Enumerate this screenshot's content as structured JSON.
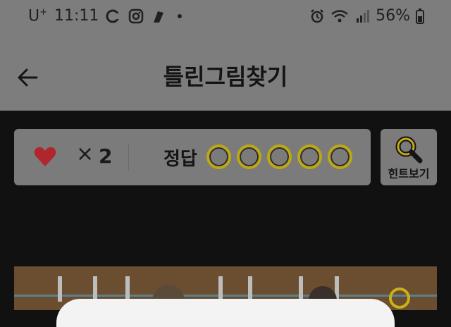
{
  "status_bar": {
    "carrier": "U",
    "carrier_sup": "+",
    "time": "11:11",
    "battery": "56%"
  },
  "header": {
    "title": "틀린그림찾기"
  },
  "game": {
    "times": "×",
    "lives": "2",
    "answer_label": "정답",
    "found": 0,
    "total": 5
  },
  "hint": {
    "label": "힌트보기"
  },
  "colors": {
    "heart": "#b0262d",
    "circle_border": "#bca717",
    "marker": "#c9b116"
  }
}
